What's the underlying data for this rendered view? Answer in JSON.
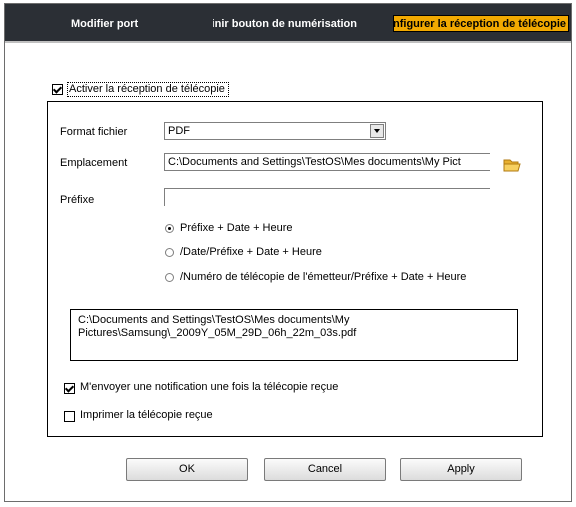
{
  "tabs": [
    {
      "label": "Modifier port"
    },
    {
      "label": "Définir bouton de numérisation"
    },
    {
      "label": "Configurer la réception de télécopie"
    }
  ],
  "enable_receive": {
    "label": "Activer la réception de télécopie",
    "checked": true
  },
  "form": {
    "format_label": "Format fichier",
    "format_value": "PDF",
    "location_label": "Emplacement",
    "location_value": "C:\\Documents and Settings\\TestOS\\Mes documents\\My Pict",
    "prefix_label": "Préfixe",
    "prefix_value": ""
  },
  "radios": [
    {
      "label": "Préfixe + Date + Heure",
      "selected": true
    },
    {
      "label": "/Date/Préfixe + Date + Heure",
      "selected": false
    },
    {
      "label": "/Numéro de télécopie de l'émetteur/Préfixe + Date + Heure",
      "selected": false
    }
  ],
  "path_preview": {
    "line1": "C:\\Documents and Settings\\TestOS\\Mes documents\\My",
    "line2": "Pictures\\Samsung\\_2009Y_05M_29D_06h_22m_03s.pdf"
  },
  "notify": {
    "label": "M'envoyer une notification une fois la télécopie reçue",
    "checked": true
  },
  "print": {
    "label": "Imprimer la télécopie reçue",
    "checked": false
  },
  "buttons": {
    "ok": "OK",
    "cancel": "Cancel",
    "apply": "Apply"
  },
  "icons": {
    "folder": "folder-icon"
  },
  "colors": {
    "tabbar": "#2b2f35",
    "active_tab": "#f2a900"
  }
}
